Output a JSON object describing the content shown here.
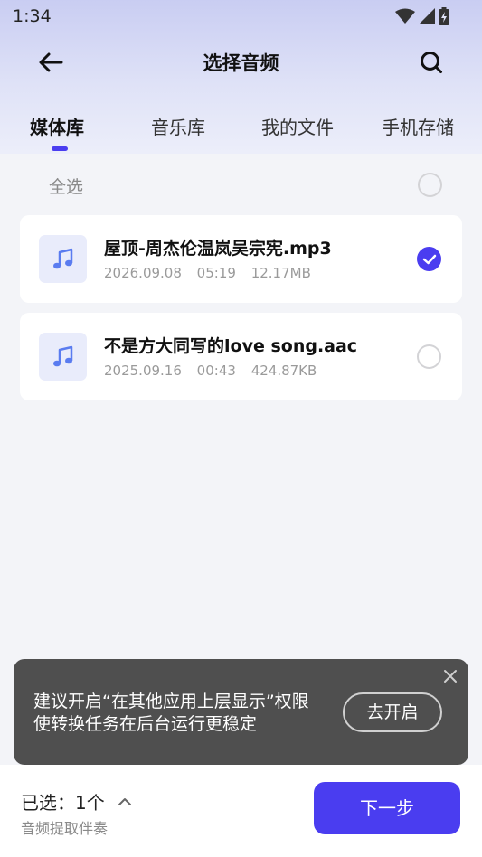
{
  "status_bar": {
    "time": "1:34"
  },
  "header": {
    "title": "选择音频"
  },
  "tabs": [
    {
      "label": "媒体库",
      "active": true
    },
    {
      "label": "音乐库",
      "active": false
    },
    {
      "label": "我的文件",
      "active": false
    },
    {
      "label": "手机存储",
      "active": false
    }
  ],
  "select_all": {
    "label": "全选",
    "checked": false
  },
  "files": [
    {
      "name": "屋顶-周杰伦温岚吴宗宪.mp3",
      "date": "2026.09.08",
      "duration": "05:19",
      "size": "12.17MB",
      "selected": true
    },
    {
      "name": "不是方大同写的love song.aac",
      "date": "2025.09.16",
      "duration": "00:43",
      "size": "424.87KB",
      "selected": false
    }
  ],
  "toast": {
    "message": "建议开启“在其他应用上层显示”权限使转换任务在后台运行更稳定",
    "button_label": "去开启"
  },
  "bottom_bar": {
    "selected_text": "已选：1个",
    "subtitle": "音频提取伴奏",
    "next_label": "下一步"
  },
  "colors": {
    "accent": "#4a3df0",
    "toast_bg": "#4f4f4f",
    "icon_blue": "#5a7cf0"
  }
}
